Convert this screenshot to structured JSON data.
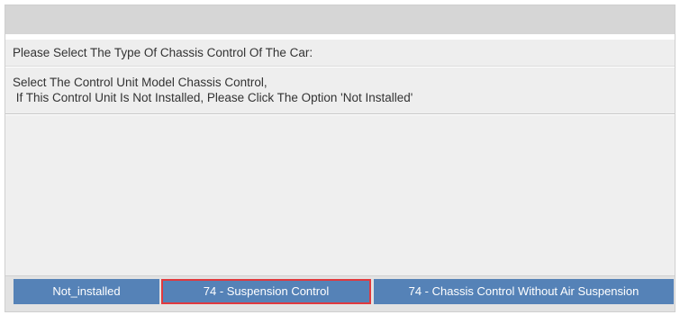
{
  "dialog": {
    "prompt": "Please Select The Type Of Chassis Control Of The Car:",
    "instructions": [
      "Select The Control Unit Model Chassis Control,",
      " If This Control Unit Is Not Installed, Please Click The Option 'Not Installed'"
    ]
  },
  "buttons": [
    {
      "label": "Not_installed"
    },
    {
      "label": "74 - Suspension Control",
      "highlighted": true
    },
    {
      "label": "74 - Chassis Control Without Air Suspension"
    }
  ],
  "colors": {
    "button_bg": "#5582b7",
    "highlight_border": "#e0393e",
    "title_bar": "#d6d6d6"
  }
}
